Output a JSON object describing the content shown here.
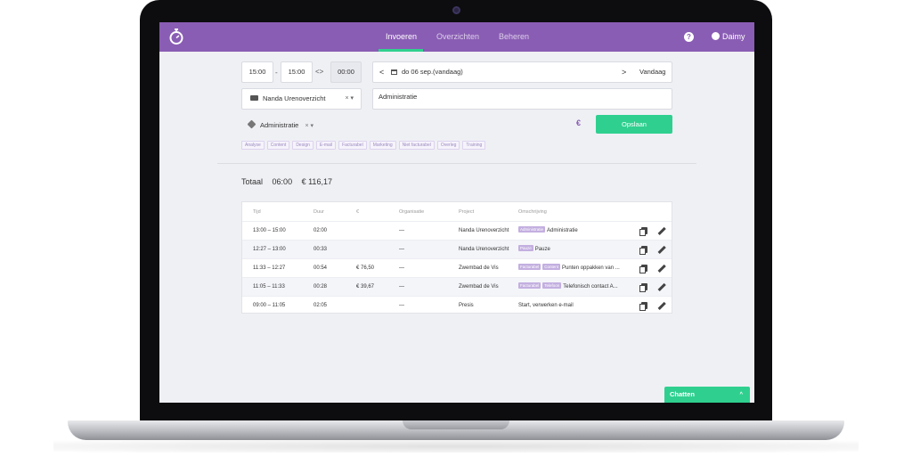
{
  "nav": {
    "items": [
      "Invoeren",
      "Overzichten",
      "Beheren"
    ],
    "user_name": "Daimy",
    "help_glyph": "?"
  },
  "entry": {
    "start_time": "15:00",
    "dash": "-",
    "end_time": "15:00",
    "swap_glyph": "<>",
    "duration": "00:00",
    "date_prev": "<",
    "date_label": "do 06 sep.(vandaag)",
    "date_next": ">",
    "today_button": "Vandaag",
    "project": "Nanda Urenoverzicht",
    "project_clear": "× ▾",
    "description": "Administratie",
    "tag": "Administratie",
    "tag_clear": "× ▾",
    "euro_glyph": "€",
    "save_button": "Opslaan",
    "tag_chips": [
      "Analyse",
      "Content",
      "Design",
      "E-mail",
      "Facturabel",
      "Marketing",
      "Niet facturabel",
      "Overleg",
      "Training"
    ]
  },
  "summary": {
    "label": "Totaal",
    "duration": "06:00",
    "amount": "€ 116,17"
  },
  "table": {
    "headers": [
      "Tijd",
      "Duur",
      "€",
      "Organisatie",
      "Project",
      "Omschrijving"
    ],
    "rows": [
      {
        "time": "13:00 – 15:00",
        "duration": "02:00",
        "amount": "",
        "org": "—",
        "project": "Nanda Urenoverzicht",
        "badges": [
          "Administratie"
        ],
        "description": "Administratie"
      },
      {
        "time": "12:27 – 13:00",
        "duration": "00:33",
        "amount": "",
        "org": "—",
        "project": "Nanda Urenoverzicht",
        "badges": [
          "Pauze"
        ],
        "description": "Pauze"
      },
      {
        "time": "11:33 – 12:27",
        "duration": "00:54",
        "amount": "€ 76,50",
        "org": "—",
        "project": "Zwembad de Vis",
        "badges": [
          "Facturabel",
          "Content"
        ],
        "description": "Punten oppakken van ..."
      },
      {
        "time": "11:05 – 11:33",
        "duration": "00:28",
        "amount": "€ 39,67",
        "org": "—",
        "project": "Zwembad de Vis",
        "badges": [
          "Facturabel",
          "Telefoon"
        ],
        "description": "Telefonisch contact A..."
      },
      {
        "time": "09:00 – 11:05",
        "duration": "02:05",
        "amount": "",
        "org": "—",
        "project": "Presis",
        "badges": [],
        "description": "Start, verwerken e-mail"
      }
    ]
  },
  "chat": {
    "label": "Chatten",
    "caret": "^"
  },
  "colors": {
    "brand": "#8a5db4",
    "accent": "#2fd08f"
  }
}
